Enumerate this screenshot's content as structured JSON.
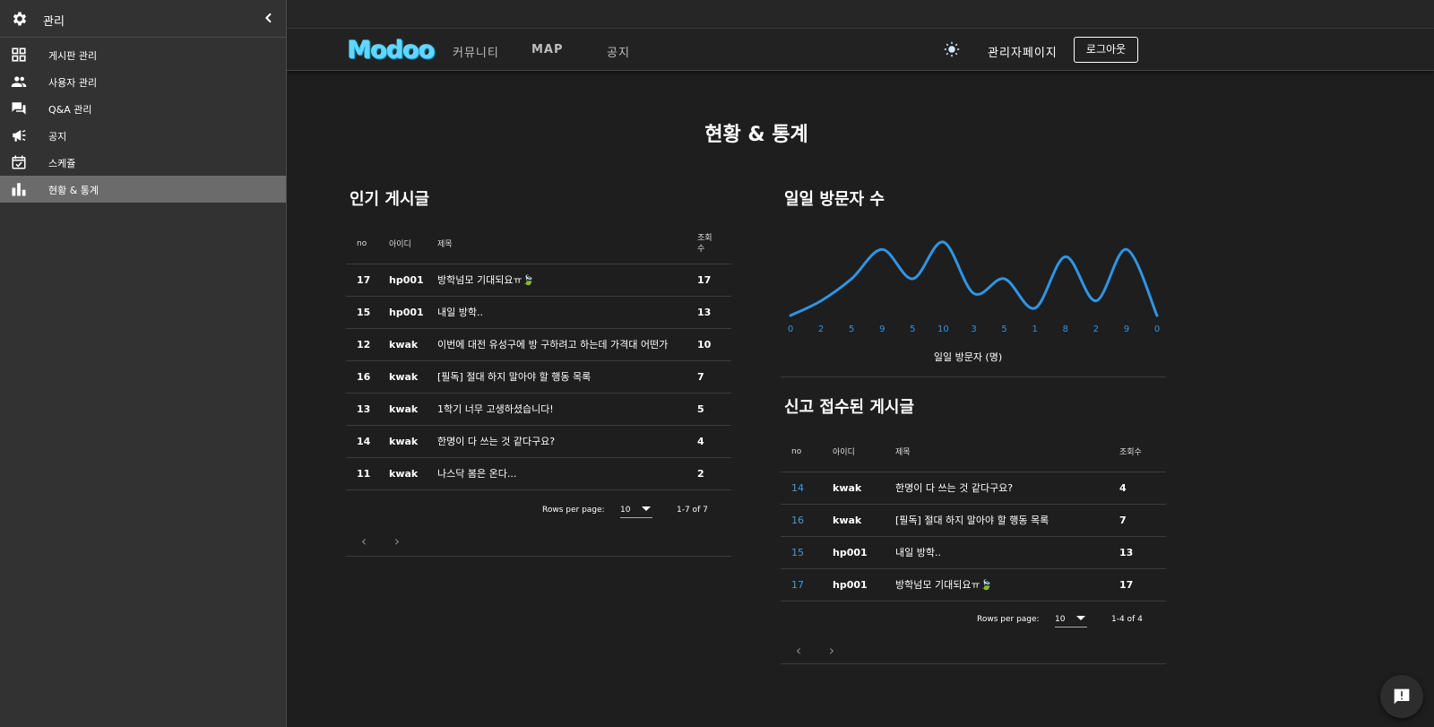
{
  "drawer": {
    "title": "관리",
    "items": [
      {
        "label": "게시판 관리",
        "icon": "grid-icon"
      },
      {
        "label": "사용자 관리",
        "icon": "users-icon"
      },
      {
        "label": "Q&A 관리",
        "icon": "forum-icon"
      },
      {
        "label": "공지",
        "icon": "megaphone-icon"
      },
      {
        "label": "스케쥴",
        "icon": "calendar-check-icon"
      },
      {
        "label": "현황 & 통계",
        "icon": "bar-chart-icon",
        "active": true
      }
    ]
  },
  "header": {
    "logo": "Modoo",
    "nav": [
      "커뮤니티",
      "MAP",
      "공지"
    ],
    "admin_page": "관리자페이지",
    "logout": "로그아웃"
  },
  "page_title": "현황 & 통계",
  "popular": {
    "title": "인기 게시글",
    "columns": [
      "no",
      "아이디",
      "제목",
      "조회\n수"
    ],
    "rows": [
      {
        "no": "17",
        "id": "hp001",
        "title": "방학넘모 기대되요ㅠ🍃",
        "views": "17"
      },
      {
        "no": "15",
        "id": "hp001",
        "title": "내일 방학..",
        "views": "13"
      },
      {
        "no": "12",
        "id": "kwak",
        "title": "이번에 대전 유성구에 방 구하려고 하는데 가격대 어떤가",
        "views": "10"
      },
      {
        "no": "16",
        "id": "kwak",
        "title": "[필독] 절대 하지 말아야 할 행동 목록",
        "views": "7"
      },
      {
        "no": "13",
        "id": "kwak",
        "title": "1학기 너무 고생하셨습니다!",
        "views": "5"
      },
      {
        "no": "14",
        "id": "kwak",
        "title": "한명이 다 쓰는 것 같다구요?",
        "views": "4"
      },
      {
        "no": "11",
        "id": "kwak",
        "title": "나스닥 봄은 온다...",
        "views": "2"
      }
    ],
    "rows_per_page_label": "Rows per page:",
    "rows_per_page": "10",
    "range": "1-7 of 7"
  },
  "visitors": {
    "title": "일일 방문자 수",
    "caption": "일일 방문자 (명)"
  },
  "chart_data": {
    "type": "line",
    "x": [
      0,
      1,
      2,
      3,
      4,
      5,
      6,
      7,
      8,
      9,
      10,
      11,
      12
    ],
    "values": [
      0,
      2,
      5,
      9,
      5,
      10,
      3,
      5,
      1,
      8,
      2,
      9,
      0
    ],
    "tick_labels": [
      "0",
      "2",
      "5",
      "9",
      "5",
      "10",
      "3",
      "5",
      "1",
      "8",
      "2",
      "9",
      "0"
    ],
    "title": "",
    "xlabel": "일일 방문자 (명)",
    "ylabel": "",
    "ylim": [
      0,
      10
    ],
    "grid": false,
    "color": "#2f95e6"
  },
  "reported": {
    "title": "신고 접수된 게시글",
    "columns": [
      "no",
      "아이디",
      "제목",
      "조회수"
    ],
    "rows": [
      {
        "no": "14",
        "id": "kwak",
        "title": "한명이 다 쓰는 것 같다구요?",
        "views": "4"
      },
      {
        "no": "16",
        "id": "kwak",
        "title": "[필독] 절대 하지 말아야 할 행동 목록",
        "views": "7"
      },
      {
        "no": "15",
        "id": "hp001",
        "title": "내일 방학..",
        "views": "13"
      },
      {
        "no": "17",
        "id": "hp001",
        "title": "방학넘모 기대되요ㅠ🍃",
        "views": "17"
      }
    ],
    "rows_per_page_label": "Rows per page:",
    "rows_per_page": "10",
    "range": "1-4 of 4"
  },
  "colors": {
    "background": "#1e1e1e",
    "drawer": "#323232",
    "active_item": "#6b6b6b",
    "link": "#3d9be9",
    "logo": "#5fd7ff"
  }
}
